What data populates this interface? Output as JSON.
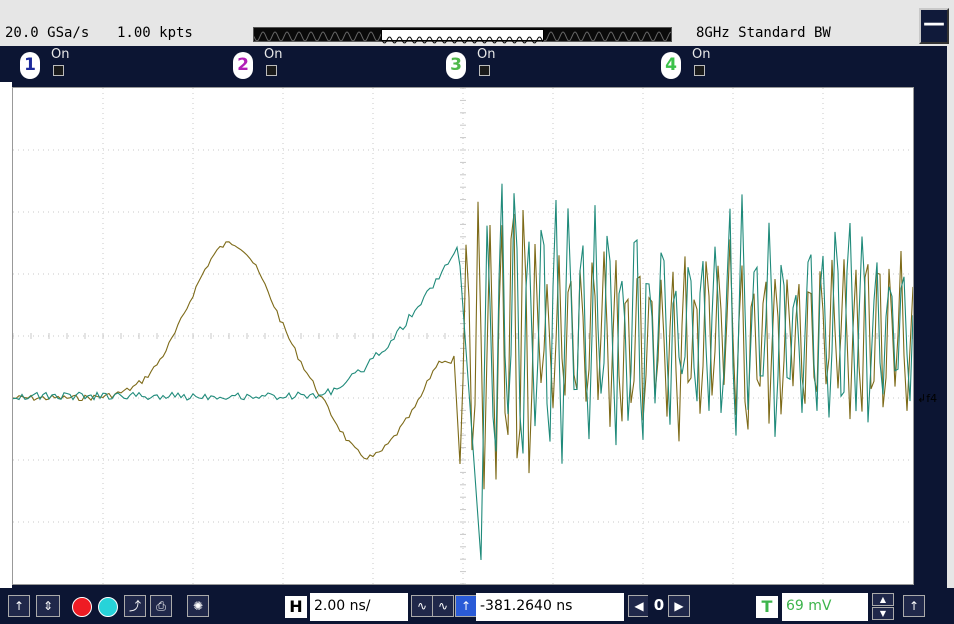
{
  "status": {
    "sample_rate": "20.0 GSa/s",
    "memory_depth": "1.00 kpts",
    "bandwidth": "8GHz Standard BW"
  },
  "window": {
    "minimize_glyph": "—"
  },
  "channels": [
    {
      "number": "1",
      "state": "On",
      "color": "#1d2a9b"
    },
    {
      "number": "2",
      "state": "On",
      "color": "#b21fb7"
    },
    {
      "number": "3",
      "state": "On",
      "color": "#4fb84a"
    },
    {
      "number": "4",
      "state": "On",
      "color": "#3cc24a"
    }
  ],
  "trace_colors": {
    "olive": "#7d6a18",
    "teal": "#1f8a7a"
  },
  "scope": {
    "trigger_marker": "↲f4"
  },
  "toolbar": {
    "horizontal_label": "H",
    "timebase": "2.00 ns/",
    "delay": "-381.2640 ns",
    "delay_step": "0",
    "trigger_label": "T",
    "trigger_level": "69 mV"
  },
  "icons": [
    "arrow-up-icon",
    "arrow-up-down-icon",
    "autoscale-icon",
    "print-icon",
    "sun-icon",
    "wave-icon",
    "chevron-left-icon",
    "chevron-right-icon",
    "triangle-up-icon",
    "triangle-down-icon"
  ]
}
